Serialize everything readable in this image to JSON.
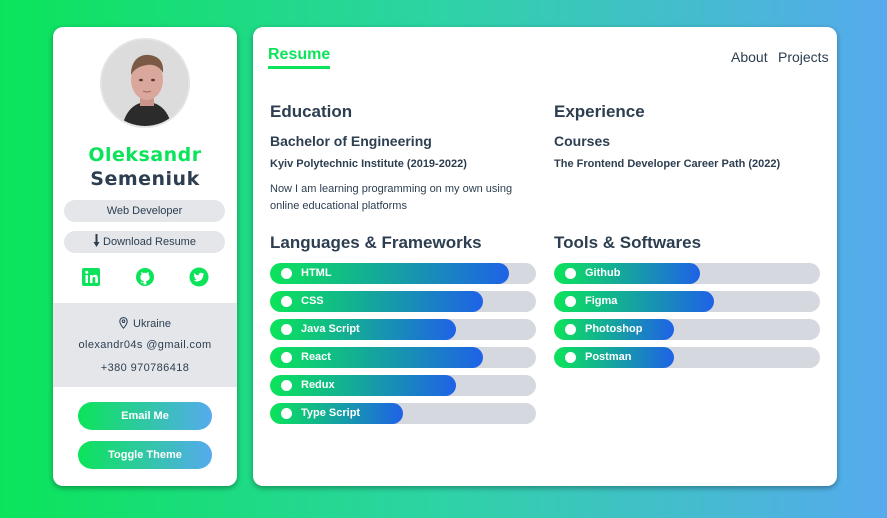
{
  "profile": {
    "first_name": "Oleksandr",
    "last_name": "Semeniuk",
    "role": "Web Developer",
    "download_label": "Download Resume",
    "location": "Ukraine",
    "email": "olexandr04s @gmail.com",
    "phone": "+380 970786418",
    "socials": [
      "linkedin-icon",
      "github-icon",
      "twitter-icon"
    ],
    "email_button": "Email Me",
    "theme_button": "Toggle Theme"
  },
  "nav": {
    "active_tab": "Resume",
    "links": [
      "About",
      "Projects"
    ]
  },
  "education": {
    "heading": "Education",
    "degree": "Bachelor of Engineering",
    "school": "Kyiv Polytechnic Institute (2019-2022)",
    "description": "Now I am learning programming on my own using online educational platforms"
  },
  "experience": {
    "heading": "Experience",
    "title": "Courses",
    "detail": "The Frontend Developer Career Path (2022)"
  },
  "languages": {
    "heading": "Languages & Frameworks",
    "items": [
      {
        "label": "HTML",
        "level": 0.9
      },
      {
        "label": "CSS",
        "level": 0.8
      },
      {
        "label": "Java Script",
        "level": 0.7
      },
      {
        "label": "React",
        "level": 0.8
      },
      {
        "label": "Redux",
        "level": 0.7
      },
      {
        "label": "Type Script",
        "level": 0.5
      }
    ]
  },
  "tools": {
    "heading": "Tools & Softwares",
    "items": [
      {
        "label": "Github",
        "level": 0.55
      },
      {
        "label": "Figma",
        "level": 0.6
      },
      {
        "label": "Photoshop",
        "level": 0.45
      },
      {
        "label": "Postman",
        "level": 0.45
      }
    ]
  },
  "colors": {
    "accent": "#0be45a",
    "accent_end": "#56aaee",
    "bar_end": "#1f62e6",
    "text": "#2c3e50",
    "track": "#d5d8de"
  }
}
